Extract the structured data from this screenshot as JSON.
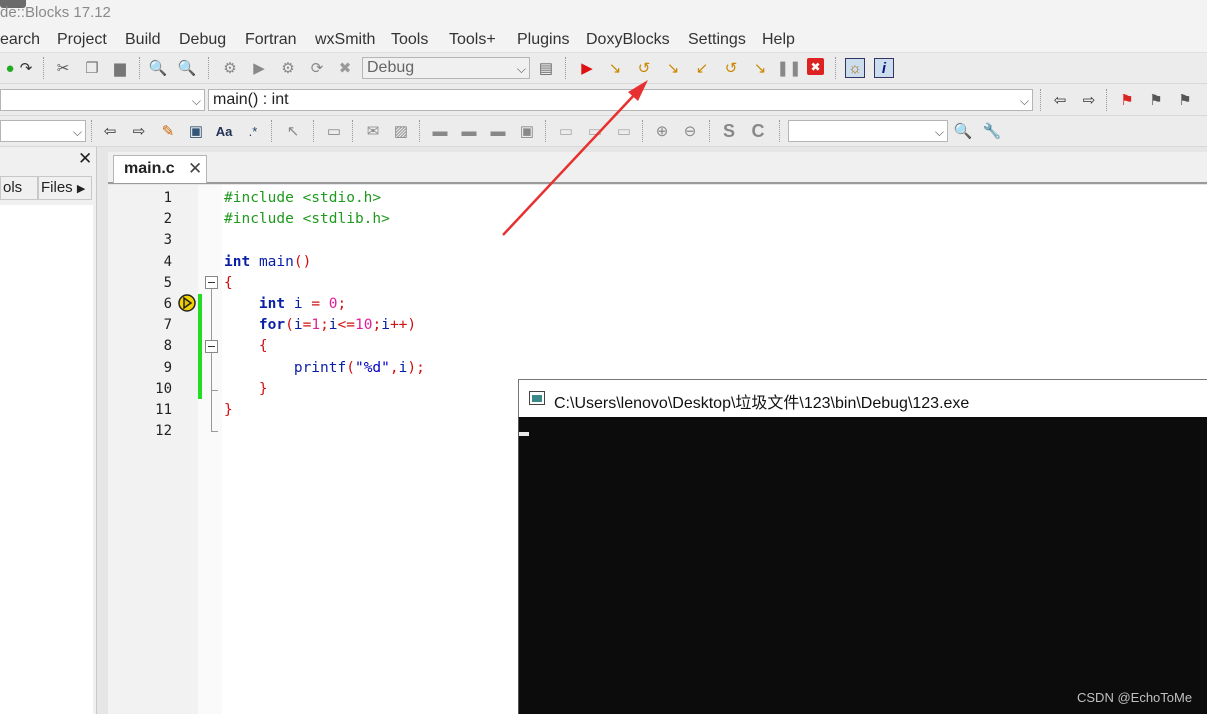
{
  "app": {
    "title": "de::Blocks 17.12"
  },
  "menu": [
    "earch",
    "Project",
    "Build",
    "Debug",
    "Fortran",
    "wxSmith",
    "Tools",
    "Tools+",
    "Plugins",
    "DoxyBlocks",
    "Settings",
    "Help"
  ],
  "toolbar": {
    "build_target": "Debug",
    "function_combo": "main() : int"
  },
  "left_panel": {
    "tab_symbols": "ols",
    "tab_files": "Files"
  },
  "editor": {
    "tab_label": "main.c",
    "line_numbers": [
      "1",
      "2",
      "3",
      "4",
      "5",
      "6",
      "7",
      "8",
      "9",
      "10",
      "11",
      "12"
    ],
    "lines": [
      "#include <stdio.h>",
      "#include <stdlib.h>",
      "",
      "int main()",
      "{",
      "    int i = 0;",
      "    for(i=1;i<=10;i++)",
      "    {",
      "        printf(\"%d\",i);",
      "    }",
      "}",
      ""
    ],
    "current_line": 6
  },
  "console": {
    "title": "C:\\Users\\lenovo\\Desktop\\垃圾文件\\123\\bin\\Debug\\123.exe"
  },
  "watermark": "CSDN @EchoToMe",
  "colors": {
    "preprocessor": "#1e9a1e",
    "keyword": "#0a1fa8",
    "number": "#e0209a",
    "string": "#0000c8",
    "change_bar": "#22dd22",
    "annotation_arrow": "#e83030",
    "console_bg": "#0c0c0c"
  }
}
